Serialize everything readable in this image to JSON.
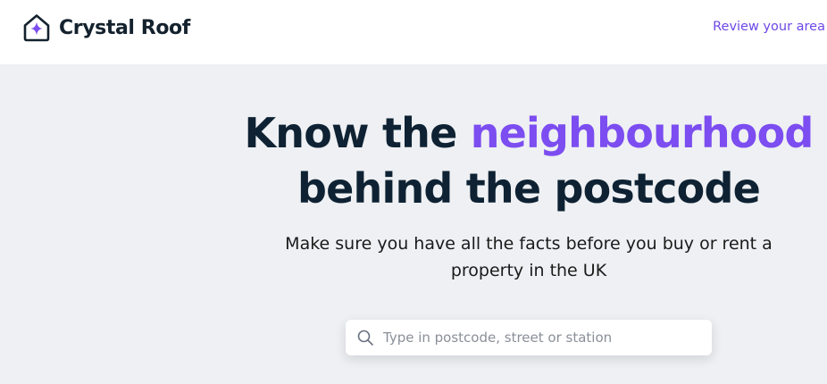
{
  "header": {
    "brand_name": "Crystal Roof",
    "nav_link": "Review your area"
  },
  "hero": {
    "headline_part1": "Know the ",
    "headline_accent": "neighbourhood",
    "headline_part2": "behind the postcode",
    "subtitle": "Make sure you have all the facts before you buy or rent a property in the UK"
  },
  "search": {
    "placeholder": "Type in postcode, street or station",
    "icon": "search-icon"
  },
  "colors": {
    "accent": "#7c4df0",
    "nav_link": "#6e48e6",
    "heading": "#0e2233",
    "hero_background": "#eef0f3"
  }
}
